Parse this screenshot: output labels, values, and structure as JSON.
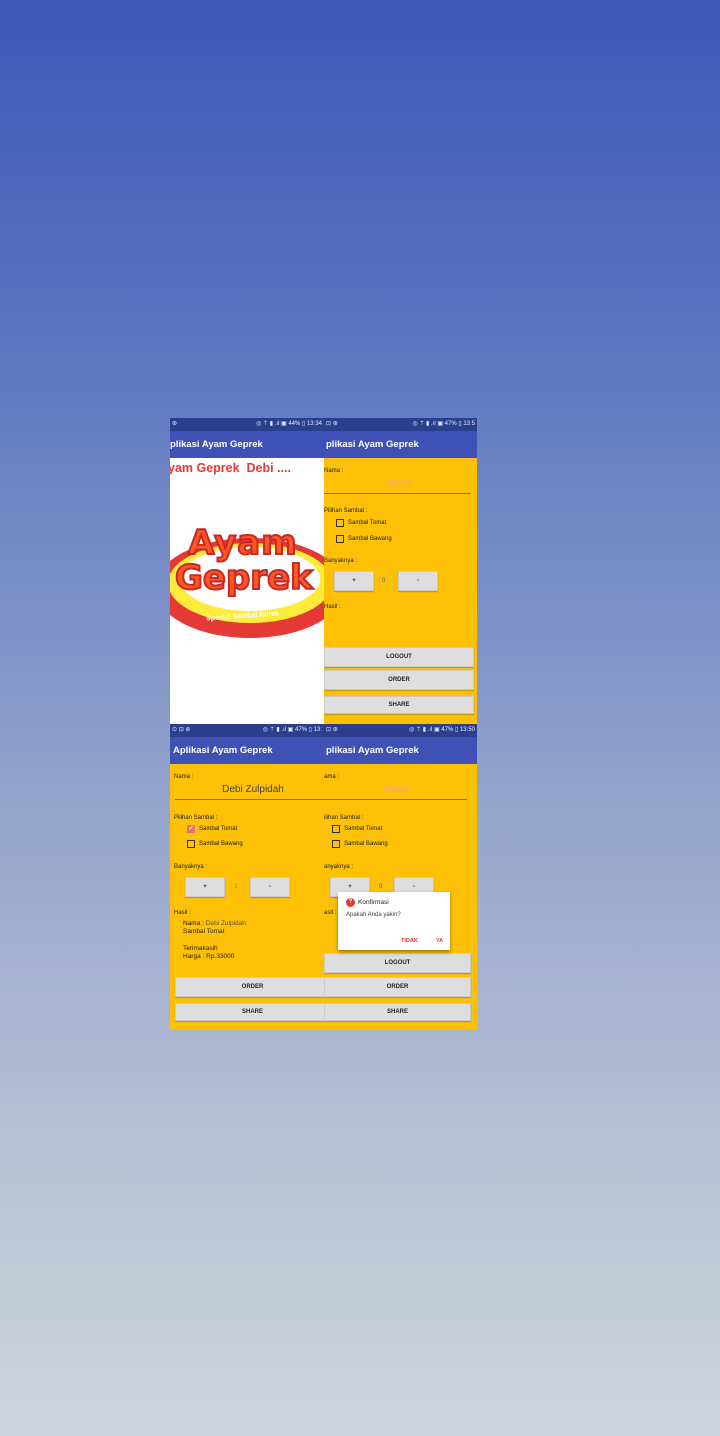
{
  "app_title": "Aplikasi Ayam Geprek",
  "panels": {
    "tl": {
      "status_left": "⊛",
      "status_right": "◎ ⇡ ▮ .ıl ▣ 44% ▯ 13:34",
      "app_title": "plikasi Ayam Geprek",
      "heading": "yam Geprek  Debi ....",
      "logo_line1": "Ayam",
      "logo_line2": "Geprek",
      "logo_tagline": "Spesial Sambal Korek"
    },
    "tr": {
      "status_left": "⊡ ⊛",
      "status_right": "◎ ⇡ ▮ .ıl ▣ 47% ▯ 13:5",
      "app_title": "plikasi Ayam Geprek",
      "nama_label": "Nama :",
      "nama_placeholder": "Nama",
      "sambal_label": "Pilihan Sambal :",
      "opt_tomat": "Sambal Tomat",
      "opt_bawang": "Sambal Bawang",
      "banyak_label": "Banyaknya :",
      "plus": "+",
      "qty": "0",
      "minus": "-",
      "hasil_label": "Hasil :",
      "logout": "LOGOUT",
      "order": "ORDER",
      "share": "SHARE"
    },
    "bl": {
      "status_left": "⊙ ⊡ ⊛",
      "status_right": "◎ ⇡ ▮ .ıl ▣ 47% ▯ 13:",
      "app_title": "Aplikasi Ayam Geprek",
      "nama_label": "Nama :",
      "nama_value": "Debi Zulpidah",
      "sambal_label": "Pilihan Sambal :",
      "opt_tomat": "Sambal Tomat",
      "opt_tomat_checked": true,
      "opt_bawang": "Sambal Bawang",
      "banyak_label": "Banyaknya :",
      "plus": "+",
      "qty": "3",
      "minus": "-",
      "hasil_label": "Hasil :",
      "result_nama_label": "Nama :",
      "result_nama_value": "Debi Zulpidah",
      "result_sambal": "Sambal Tomat",
      "result_thanks": "Terimakasih",
      "result_price": "Harga : Rp.33000",
      "order": "ORDER",
      "share": "SHARE"
    },
    "br": {
      "status_left": "⊡ ⊛",
      "status_right": "◎ ⇡ ▮ .ıl ▣ 47% ▯ 13:50",
      "app_title": "plikasi Ayam Geprek",
      "nama_label": "ama :",
      "nama_placeholder": "Nama",
      "sambal_label": "ilihan Sambal :",
      "opt_tomat": "Sambal Tomat",
      "opt_bawang": "Sambal Bawang",
      "banyak_label": "anyaknya :",
      "plus": "+",
      "qty": "0",
      "minus": "-",
      "hasil_label": "asil :",
      "logout": "LOGOUT",
      "order": "ORDER",
      "share": "SHARE",
      "dialog": {
        "title": "Konfirmasi",
        "message": "Apakah Anda yakin?",
        "no": "TIDAK",
        "yes": "YA"
      }
    }
  },
  "colors": {
    "primary": "#3f51b5",
    "status": "#2c3f8e",
    "background": "#ffc107",
    "accent": "#e53935"
  }
}
